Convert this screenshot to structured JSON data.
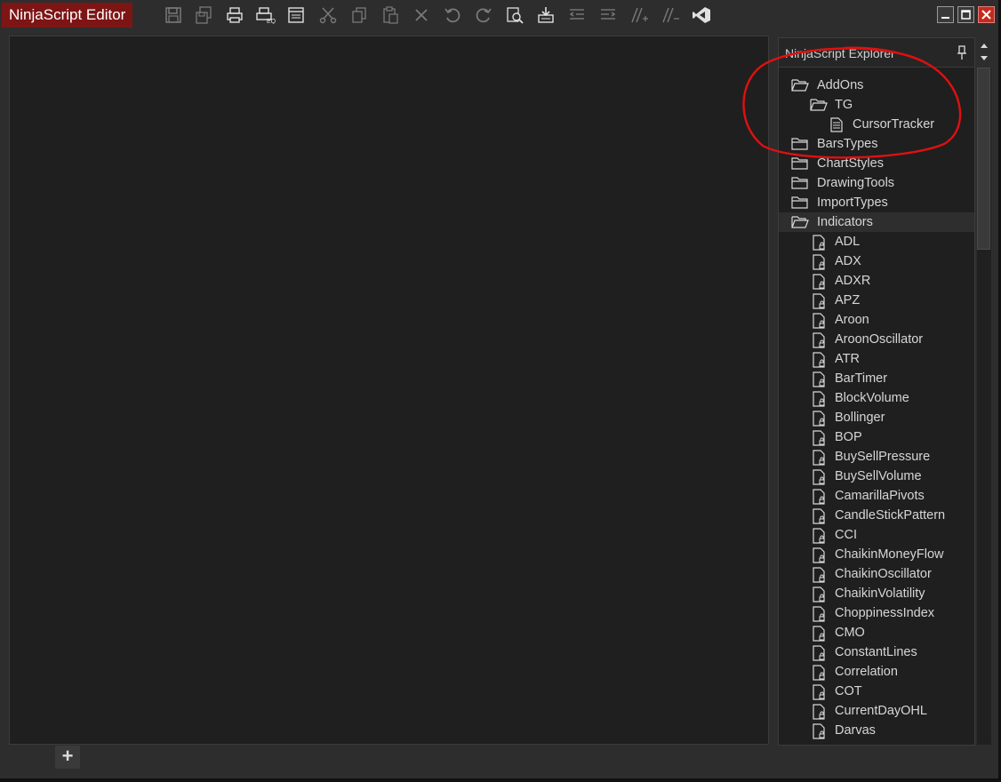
{
  "app": {
    "title": "NinjaScript Editor"
  },
  "toolbar": {
    "icons": [
      "save-icon",
      "save-all-icon",
      "print-icon",
      "print-preview-icon",
      "template-icon",
      "cut-icon",
      "copy-icon",
      "paste-icon",
      "delete-icon",
      "undo-icon",
      "redo-icon",
      "find-icon",
      "compile-icon",
      "outdent-icon",
      "indent-icon",
      "comment-icon",
      "uncomment-icon",
      "visual-studio-icon"
    ]
  },
  "window_controls": {
    "minimize": "▁",
    "maximize": "☐",
    "close": "✕"
  },
  "explorer": {
    "title": "NinjaScript Explorer",
    "folders": {
      "addons": "AddOns",
      "tg": "TG",
      "cursortracker": "CursorTracker",
      "barstypes": "BarsTypes",
      "chartstyles": "ChartStyles",
      "drawingtools": "DrawingTools",
      "importtypes": "ImportTypes",
      "indicators": "Indicators"
    },
    "indicators": [
      "ADL",
      "ADX",
      "ADXR",
      "APZ",
      "Aroon",
      "AroonOscillator",
      "ATR",
      "BarTimer",
      "BlockVolume",
      "Bollinger",
      "BOP",
      "BuySellPressure",
      "BuySellVolume",
      "CamarillaPivots",
      "CandleStickPattern",
      "CCI",
      "ChaikinMoneyFlow",
      "ChaikinOscillator",
      "ChaikinVolatility",
      "ChoppinessIndex",
      "CMO",
      "ConstantLines",
      "Correlation",
      "COT",
      "CurrentDayOHL",
      "Darvas"
    ]
  },
  "bottom": {
    "add_tab": "+"
  },
  "colors": {
    "title_bg": "#7d1515",
    "annotation": "#e01010",
    "panel_bg": "#1f1f1f"
  }
}
